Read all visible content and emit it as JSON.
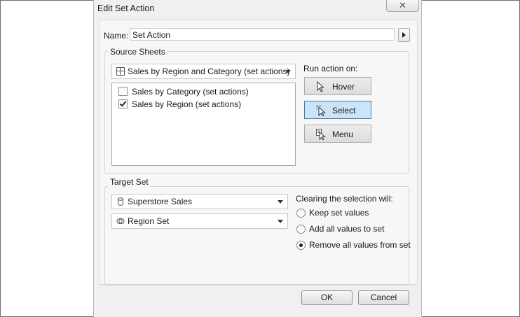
{
  "window": {
    "title": "Edit Set Action"
  },
  "name": {
    "label": "Name:",
    "value": "Set Action"
  },
  "source_sheets": {
    "label": "Source Sheets",
    "selected": "Sales by Region and Category (set actions)",
    "sheets": [
      {
        "label": "Sales by Category (set actions)",
        "checked": false
      },
      {
        "label": "Sales by Region  (set actions)",
        "checked": true
      }
    ]
  },
  "run_action": {
    "label": "Run action on:",
    "options": [
      {
        "label": "Hover",
        "icon": "cursor-icon",
        "selected": false
      },
      {
        "label": "Select",
        "icon": "select-cursor-icon",
        "selected": true
      },
      {
        "label": "Menu",
        "icon": "menu-cursor-icon",
        "selected": false
      }
    ]
  },
  "target_set": {
    "label": "Target Set",
    "datasource": "Superstore Sales",
    "set": "Region Set"
  },
  "clearing": {
    "label": "Clearing the selection will:",
    "options": [
      {
        "label": "Keep set values",
        "selected": false
      },
      {
        "label": "Add all values to set",
        "selected": false
      },
      {
        "label": "Remove all values from set",
        "selected": true
      }
    ]
  },
  "buttons": {
    "ok": "OK",
    "cancel": "Cancel"
  },
  "colors": {
    "selected_bg": "#cce4f7",
    "selected_border": "#3c7fb1"
  }
}
